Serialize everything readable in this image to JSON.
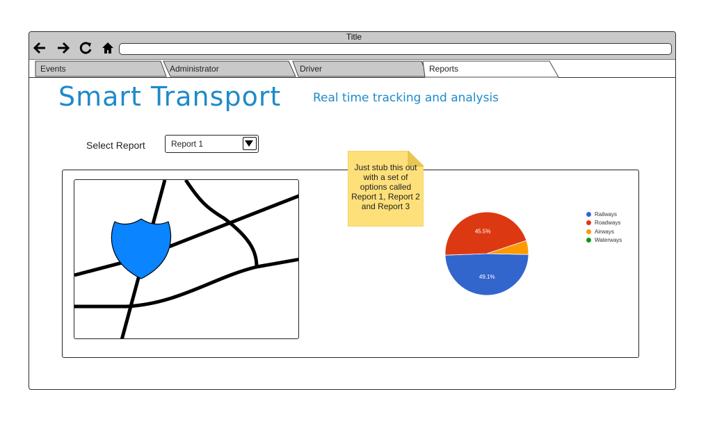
{
  "window": {
    "title": "Title"
  },
  "nav": {
    "back_icon": "arrow-left-icon",
    "forward_icon": "arrow-right-icon",
    "reload_icon": "reload-icon",
    "home_icon": "home-icon",
    "url_value": ""
  },
  "tabs": [
    {
      "label": "Events",
      "active": false
    },
    {
      "label": "Administrator",
      "active": false
    },
    {
      "label": "Driver",
      "active": false
    },
    {
      "label": "Reports",
      "active": true
    }
  ],
  "header": {
    "brand": "Smart Transport",
    "tagline": "Real time tracking and analysis"
  },
  "report_select": {
    "label": "Select Report",
    "value": "Report 1"
  },
  "sticky_note": {
    "lines": [
      "Just stub this out",
      "with a set of",
      "options called",
      "Report 1, Report 2",
      "and Report 3"
    ]
  },
  "map": {
    "icon": "highway-shield-icon"
  },
  "chart_data": {
    "type": "pie",
    "slices": [
      {
        "name": "Railways",
        "value": 49.1,
        "color": "#3366cc",
        "label": "49.1%"
      },
      {
        "name": "Roadways",
        "value": 45.5,
        "color": "#dc3912",
        "label": "45.5%"
      },
      {
        "name": "Airways",
        "value": 5.4,
        "color": "#ff9900",
        "label": ""
      },
      {
        "name": "Waterways",
        "value": 0,
        "color": "#109618",
        "label": ""
      }
    ],
    "legend_position": "right"
  },
  "colors": {
    "brand": "#1e8ac9",
    "sticky": "#fde07a",
    "shield": "#0a84ff"
  }
}
